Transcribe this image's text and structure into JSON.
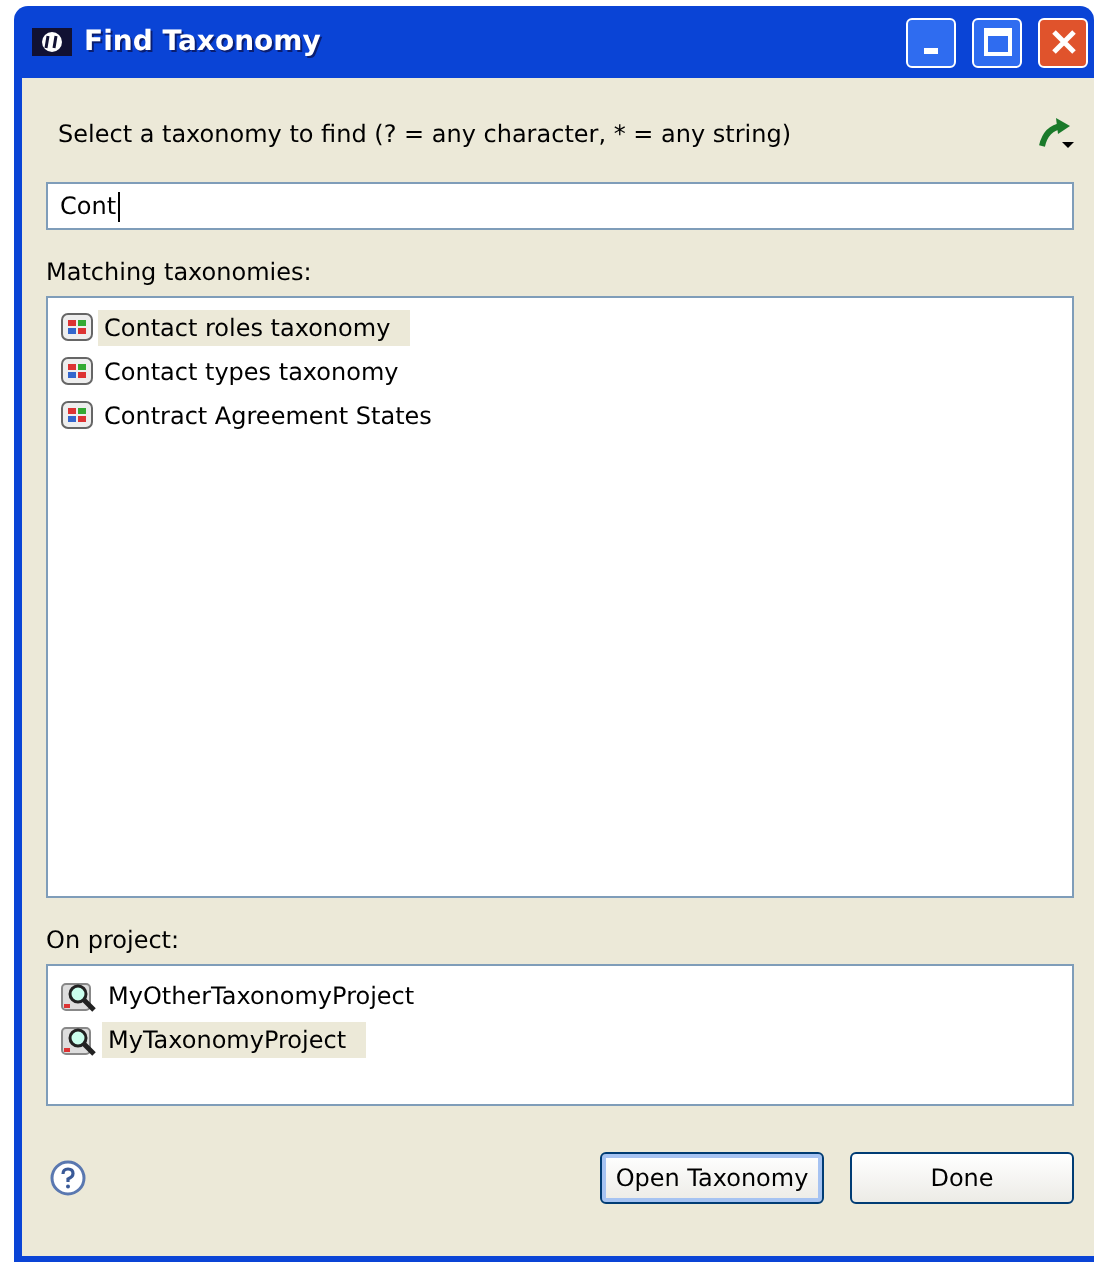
{
  "window": {
    "title": "Find Taxonomy"
  },
  "prompt": "Select a taxonomy to find (? = any character, * = any string)",
  "search": {
    "value": "Cont"
  },
  "matching": {
    "label": "Matching taxonomies:",
    "items": [
      {
        "label": "Contact roles taxonomy",
        "selected": true
      },
      {
        "label": "Contact types taxonomy",
        "selected": false
      },
      {
        "label": "Contract Agreement States",
        "selected": false
      }
    ]
  },
  "project": {
    "label": "On project:",
    "items": [
      {
        "label": "MyOtherTaxonomyProject",
        "selected": false
      },
      {
        "label": "MyTaxonomyProject",
        "selected": true
      }
    ]
  },
  "buttons": [
    {
      "label": "Open Taxonomy",
      "kind": "default"
    },
    {
      "label": "Done",
      "kind": "normal"
    }
  ]
}
